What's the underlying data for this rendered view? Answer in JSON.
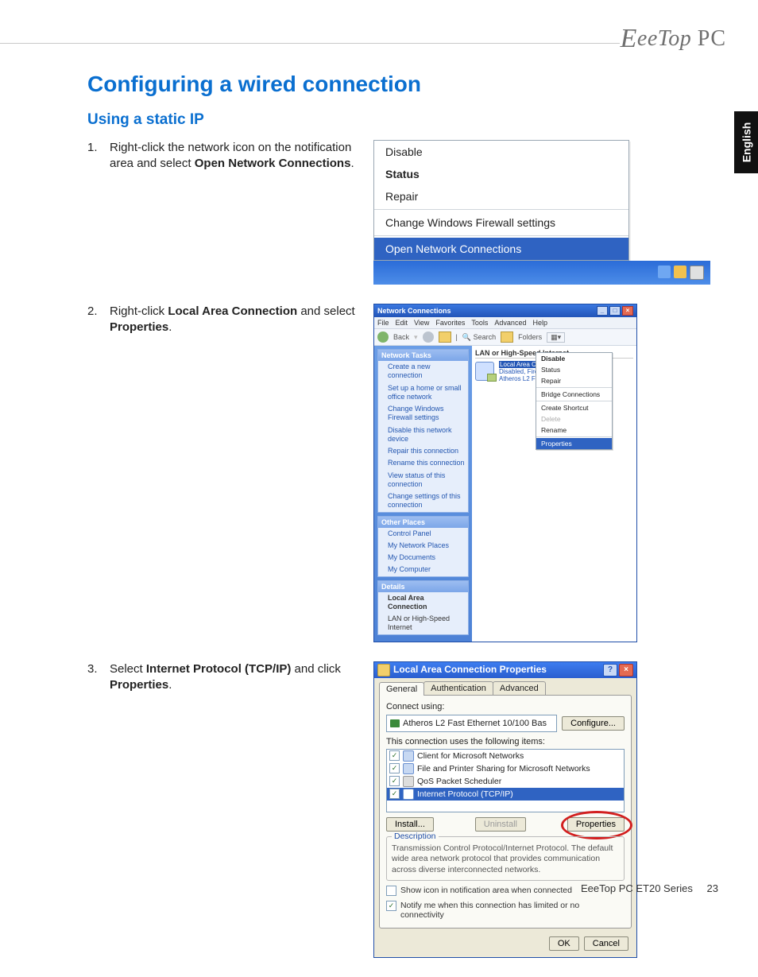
{
  "brand": {
    "full": "EeeTop PC"
  },
  "lang_tab": "English",
  "title": "Configuring a wired connection",
  "subtitle": "Using a static IP",
  "steps": {
    "s1": {
      "num": "1.",
      "pre": "Right-click the network icon on the notification area and select ",
      "bold": "Open Network Connections",
      "post": "."
    },
    "s2": {
      "num": "2.",
      "pre": "Right-click ",
      "bold1": "Local Area Connection",
      "mid": " and select ",
      "bold2": "Properties",
      "post": "."
    },
    "s3": {
      "num": "3.",
      "pre": "Select ",
      "bold1": "Internet Protocol (TCP/IP)",
      "mid": " and click ",
      "bold2": "Properties",
      "post": "."
    }
  },
  "fig1": {
    "disable": "Disable",
    "status": "Status",
    "repair": "Repair",
    "firewall": "Change Windows Firewall settings",
    "open_net": "Open Network Connections"
  },
  "fig2": {
    "title": "Network Connections",
    "menubar": [
      "File",
      "Edit",
      "View",
      "Favorites",
      "Tools",
      "Advanced",
      "Help"
    ],
    "toolbar": {
      "back": "Back",
      "search": "Search",
      "folders": "Folders"
    },
    "side_tasks_head": "Network Tasks",
    "side_tasks": [
      "Create a new connection",
      "Set up a home or small office network",
      "Change Windows Firewall settings",
      "Disable this network device",
      "Repair this connection",
      "Rename this connection",
      "View status of this connection",
      "Change settings of this connection"
    ],
    "other_head": "Other Places",
    "other": [
      "Control Panel",
      "My Network Places",
      "My Documents",
      "My Computer"
    ],
    "details_head": "Details",
    "details": [
      "Local Area Connection",
      "LAN or High-Speed Internet"
    ],
    "group": "LAN or High-Speed Internet",
    "conn_name": "Local Area Connection",
    "conn_sub1": "Disabled, Firewalled",
    "conn_sub2": "Atheros L2 Fast",
    "ctx": {
      "disable": "Disable",
      "status": "Status",
      "repair": "Repair",
      "bridge": "Bridge Connections",
      "shortcut": "Create Shortcut",
      "delete": "Delete",
      "rename": "Rename",
      "properties": "Properties"
    }
  },
  "fig3": {
    "title": "Local Area Connection Properties",
    "tabs": {
      "general": "General",
      "auth": "Authentication",
      "adv": "Advanced"
    },
    "connect_using": "Connect using:",
    "nic": "Atheros L2 Fast Ethernet 10/100 Bas",
    "configure": "Configure...",
    "uses_items": "This connection uses the following items:",
    "items": {
      "client": "Client for Microsoft Networks",
      "fps": "File and Printer Sharing for Microsoft Networks",
      "qos": "QoS Packet Scheduler",
      "tcpip": "Internet Protocol (TCP/IP)"
    },
    "install": "Install...",
    "uninstall": "Uninstall",
    "properties": "Properties",
    "desc_head": "Description",
    "desc": "Transmission Control Protocol/Internet Protocol. The default wide area network protocol that provides communication across diverse interconnected networks.",
    "show_icon": "Show icon in notification area when connected",
    "notify": "Notify me when this connection has limited or no connectivity",
    "ok": "OK",
    "cancel": "Cancel"
  },
  "footer": {
    "series": "EeeTop PC ET20 Series",
    "page": "23"
  }
}
